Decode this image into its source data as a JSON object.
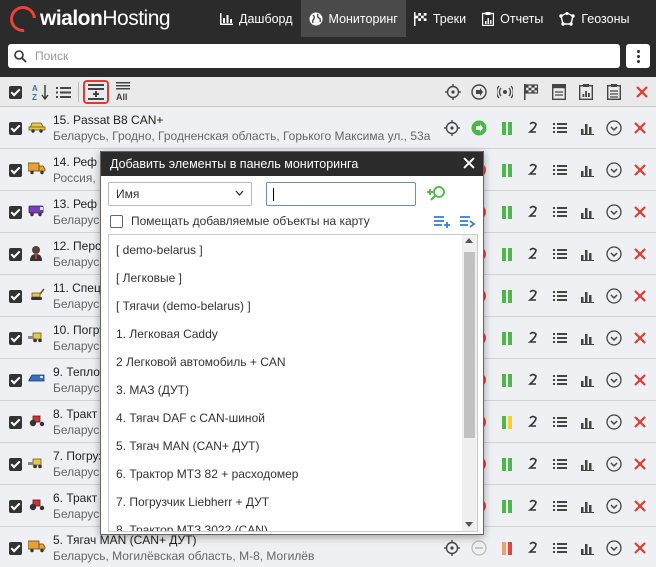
{
  "brand": {
    "bold": "wialon",
    "light": "Hosting"
  },
  "nav": [
    {
      "label": "Дашборд",
      "icon": "bar-chart-icon",
      "active": false
    },
    {
      "label": "Мониторинг",
      "icon": "globe-icon",
      "active": true
    },
    {
      "label": "Треки",
      "icon": "checkered-flag-icon",
      "active": false
    },
    {
      "label": "Отчеты",
      "icon": "report-icon",
      "active": false
    },
    {
      "label": "Геозоны",
      "icon": "geofence-icon",
      "active": false
    }
  ],
  "search": {
    "placeholder": "Поиск"
  },
  "toolbar": {
    "left_icons": [
      "select-all-checkbox",
      "sort-az-icon",
      "list-icon",
      "add-items-icon",
      "all-icon"
    ],
    "all_label": "All"
  },
  "units": [
    {
      "name": "15. Passat B8 CAN+",
      "address": "Беларусь, Гродно, Гродненская область, Горького Максима ул., 53а",
      "icon": "car-icon"
    },
    {
      "name": "14. Реф",
      "address": "Россия,",
      "icon": "truck-icon"
    },
    {
      "name": "13. Реф",
      "address": "Беларусь",
      "icon": "van-icon"
    },
    {
      "name": "12. Перс",
      "address": "Беларусь",
      "icon": "person-icon"
    },
    {
      "name": "11. Спец",
      "address": "Беларусь",
      "icon": "excavator-icon"
    },
    {
      "name": "10. Погру",
      "address": "Беларусь",
      "icon": "loader-icon"
    },
    {
      "name": "9. Тепло",
      "address": "Беларусь",
      "icon": "locomotive-icon"
    },
    {
      "name": "8. Тракт",
      "address": "Беларусь",
      "icon": "tractor-icon"
    },
    {
      "name": "7. Погруз",
      "address": "Беларусь",
      "icon": "loader-icon"
    },
    {
      "name": "6. Тракт",
      "address": "Беларусь",
      "icon": "tractor-icon"
    },
    {
      "name": "5. Тягач MAN (CAN+ ДУТ)",
      "address": "Беларусь, Могилёвская область, М-8, Могилёв",
      "icon": "truck-icon"
    }
  ],
  "dialog": {
    "title": "Добавить элементы в панель мониторинга",
    "filter_select": "Имя",
    "checkbox_label": "Помещать добавляемые объекты на карту",
    "items": [
      "[ demo-belarus ]",
      "[ Легковые ]",
      "[ Тягачи (demo-belarus) ]",
      "1. Легковая Caddy",
      "2 Легковой автомобиль + CAN",
      "3. МАЗ (ДУТ)",
      "4. Тягач DAF с CAN-шиной",
      "5. Тягач MAN (CAN+ ДУТ)",
      "6. Трактор МТЗ 82 + расходомер",
      "7. Погрузчик Liebherr + ДУТ",
      "8. Трактор МТЗ 3022 (CAN)"
    ]
  },
  "colors": {
    "accent_red": "#e03a32",
    "nav_bg": "#2b2b2b",
    "green": "#4cb848"
  }
}
